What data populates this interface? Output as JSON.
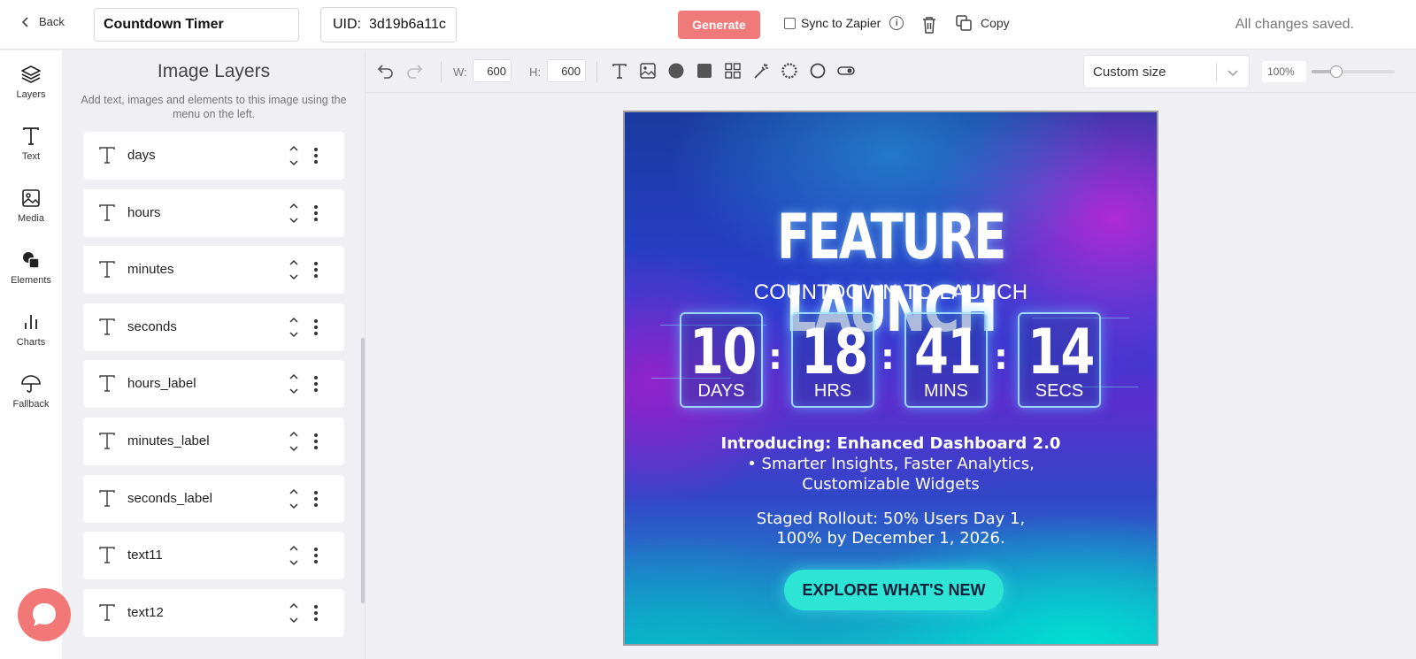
{
  "header": {
    "back_label": "Back",
    "title_value": "Countdown Timer",
    "uid_label": "UID:",
    "uid_value": "3d19b6a11c",
    "generate_label": "Generate",
    "sync_label": "Sync to Zapier",
    "copy_label": "Copy",
    "status": "All changes saved."
  },
  "sidebar": {
    "items": [
      {
        "label": "Layers",
        "icon": "layers-icon"
      },
      {
        "label": "Text",
        "icon": "text-icon"
      },
      {
        "label": "Media",
        "icon": "image-icon"
      },
      {
        "label": "Elements",
        "icon": "elements-icon"
      },
      {
        "label": "Charts",
        "icon": "bar-chart-icon"
      },
      {
        "label": "Fallback",
        "icon": "umbrella-icon"
      }
    ]
  },
  "layers_panel": {
    "title": "Image Layers",
    "subtitle": "Add text, images and elements to this image using the menu on the left.",
    "items": [
      {
        "name": "days"
      },
      {
        "name": "hours"
      },
      {
        "name": "minutes"
      },
      {
        "name": "seconds"
      },
      {
        "name": "hours_label"
      },
      {
        "name": "minutes_label"
      },
      {
        "name": "seconds_label"
      },
      {
        "name": "text11"
      },
      {
        "name": "text12"
      }
    ]
  },
  "toolbar": {
    "width_label": "W:",
    "width_value": "600",
    "height_label": "H:",
    "height_value": "600",
    "size_option": "Custom size",
    "zoom_label": "100%",
    "zoom_level": 0.3
  },
  "artboard": {
    "title": "FEATURE LAUNCH",
    "subtitle": "COUNTDOWN TO LAUNCH",
    "countdown": [
      {
        "value": "10",
        "label": "DAYS"
      },
      {
        "value": "18",
        "label": "HRS"
      },
      {
        "value": "41",
        "label": "MINS"
      },
      {
        "value": "14",
        "label": "SECS"
      }
    ],
    "colon": ":",
    "intro": "Introducing: Enhanced Dashboard 2.0",
    "line1": "• Smarter Insights, Faster Analytics,",
    "line2": "Customizable Widgets",
    "line3": "Staged Rollout: 50% Users Day 1,",
    "line4": "100% by December 1, 2026.",
    "cta": "EXPLORE WHAT'S NEW"
  },
  "colors": {
    "accent": "#f07a7a",
    "cta": "#2ee5d5"
  }
}
